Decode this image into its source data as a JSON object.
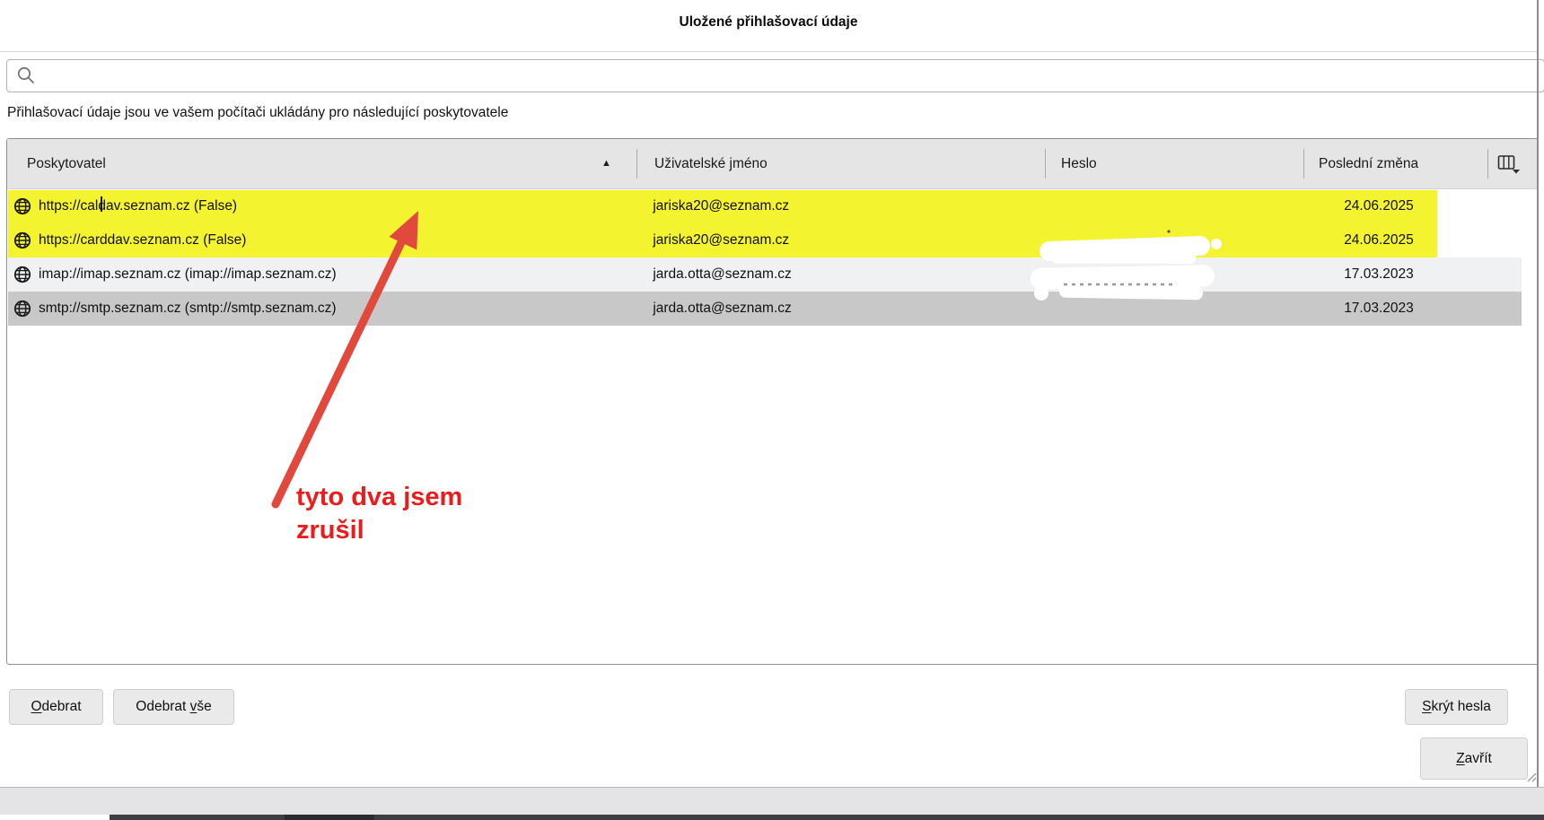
{
  "dialog": {
    "title": "Uložené přihlašovací údaje",
    "description": "Přihlašovací údaje jsou ve vašem počítači ukládány pro následující poskytovatele",
    "search": {
      "value": "",
      "placeholder": ""
    }
  },
  "table": {
    "columns": {
      "provider": "Poskytovatel",
      "username": "Uživatelské jméno",
      "password": "Heslo",
      "last_changed": "Poslední změna"
    },
    "sort": {
      "column": "provider",
      "direction": "ascending",
      "indicator": "▲"
    },
    "rows": [
      {
        "provider": "https://caldav.seznam.cz (False)",
        "username": "jariska20@seznam.cz",
        "password": "",
        "password_obscured": false,
        "last_changed": "24.06.2025",
        "highlighted": true,
        "selected": false
      },
      {
        "provider": "https://carddav.seznam.cz (False)",
        "username": "jariska20@seznam.cz",
        "password": "",
        "password_obscured": false,
        "last_changed": "24.06.2025",
        "highlighted": true,
        "selected": false
      },
      {
        "provider": "imap://imap.seznam.cz (imap://imap.seznam.cz)",
        "username": "jarda.otta@seznam.cz",
        "password": "",
        "password_obscured": true,
        "last_changed": "17.03.2023",
        "highlighted": false,
        "selected": false
      },
      {
        "provider": "smtp://smtp.seznam.cz (smtp://smtp.seznam.cz)",
        "username": "jarda.otta@seznam.cz",
        "password": "",
        "password_obscured": true,
        "last_changed": "17.03.2023",
        "highlighted": false,
        "selected": true
      }
    ]
  },
  "buttons": {
    "remove": {
      "pre": "",
      "key": "O",
      "post": "debrat"
    },
    "remove_all": {
      "pre": "Odebrat ",
      "key": "v",
      "post": "še"
    },
    "hide_passwords": {
      "pre": "",
      "key": "S",
      "post": "krýt hesla"
    },
    "close": {
      "pre": "",
      "key": "Z",
      "post": "avřít"
    }
  },
  "annotation": {
    "line1": "tyto dva jsem",
    "line2": "zrušil"
  },
  "icons": {
    "search": "magnifier",
    "row_site": "globe",
    "sort": "triangle-up",
    "column_picker": "table-columns-with-arrow"
  },
  "colors": {
    "highlight_yellow": "#f3f330",
    "annotation_red": "#ed1c1c",
    "arrow_red": "#e2493d",
    "selected_row_gray": "#c8c8c8",
    "alt_row_gray": "#eff1f3",
    "header_gray": "#e5e5e5"
  }
}
